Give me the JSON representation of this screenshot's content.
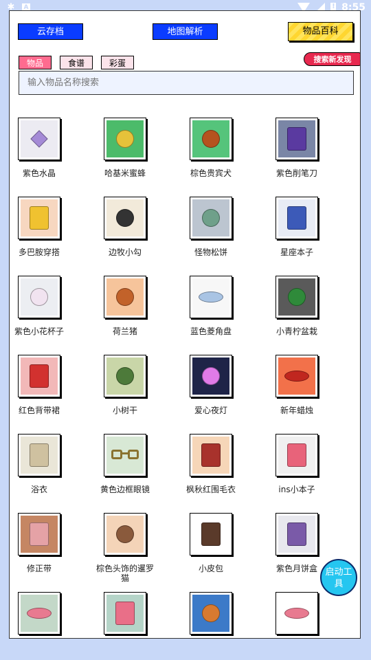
{
  "status_bar": {
    "time": "8:55",
    "left_icons": [
      "bug-icon",
      "a-box-icon"
    ],
    "right_icons": [
      "wifi-icon",
      "signal-icon",
      "battery-alert-icon"
    ]
  },
  "toolbar": {
    "cloud_label": "云存档",
    "map_label": "地图解析",
    "wiki_label": "物品百科"
  },
  "tabs": [
    {
      "label": "物品",
      "active": true
    },
    {
      "label": "食谱",
      "active": false
    },
    {
      "label": "彩蛋",
      "active": false
    }
  ],
  "discovery_badge": "搜索新发现",
  "search": {
    "placeholder": "输入物品名称搜索",
    "value": ""
  },
  "items": [
    {
      "label": "紫色水晶",
      "bg": "#ecebf2",
      "icon": "purple-crystal-icon",
      "color": "#a48ad6",
      "shape": "gem"
    },
    {
      "label": "哈基米蜜蜂",
      "bg": "#4cbb6a",
      "icon": "bee-icon",
      "color": "#e6c23a",
      "shape": "circle"
    },
    {
      "label": "棕色贵宾犬",
      "bg": "#55c47b",
      "icon": "poodle-icon",
      "color": "#b5531f",
      "shape": "circle"
    },
    {
      "label": "紫色削笔刀",
      "bg": "#7a86a6",
      "icon": "pencil-sharpener-icon",
      "color": "#5a3aa0",
      "shape": "rect"
    },
    {
      "label": "多巴胺穿搭",
      "bg": "#f7d7c0",
      "icon": "outfit-icon",
      "color": "#f0c230",
      "shape": "rect"
    },
    {
      "label": "边牧小勾",
      "bg": "#f2eada",
      "icon": "border-collie-icon",
      "color": "#333333",
      "shape": "circle"
    },
    {
      "label": "怪物松饼",
      "bg": "#bcc5d0",
      "icon": "monster-muffin-icon",
      "color": "#6fa08a",
      "shape": "circle"
    },
    {
      "label": "星座本子",
      "bg": "#e8ecf5",
      "icon": "notebook-icon",
      "color": "#3c5ab8",
      "shape": "rect"
    },
    {
      "label": "紫色小花杯子",
      "bg": "#eceef2",
      "icon": "flower-cup-icon",
      "color": "#f1e3f0",
      "shape": "circle"
    },
    {
      "label": "荷兰猪",
      "bg": "#f6c49b",
      "icon": "guinea-pig-icon",
      "color": "#c2622a",
      "shape": "circle"
    },
    {
      "label": "蓝色菱角盘",
      "bg": "#f7f7f7",
      "icon": "plate-icon",
      "color": "#a9c4e4",
      "shape": "ellipse"
    },
    {
      "label": "小青柠盆栽",
      "bg": "#5a5a5a",
      "icon": "lime-plant-icon",
      "color": "#2f8a3a",
      "shape": "circle"
    },
    {
      "label": "红色背带裙",
      "bg": "#f2b8b8",
      "icon": "red-dress-icon",
      "color": "#d2312f",
      "shape": "rect"
    },
    {
      "label": "小树干",
      "bg": "#c9d6a8",
      "icon": "tree-trunk-icon",
      "color": "#4d7a3a",
      "shape": "circle"
    },
    {
      "label": "爱心夜灯",
      "bg": "#1e2448",
      "icon": "heart-lamp-icon",
      "color": "#e07be8",
      "shape": "circle"
    },
    {
      "label": "新年蜡烛",
      "bg": "#f2714a",
      "icon": "candle-icon",
      "color": "#c0271f",
      "shape": "ellipse"
    },
    {
      "label": "浴衣",
      "bg": "#eae6d8",
      "icon": "bathrobe-icon",
      "color": "#cfc1a0",
      "shape": "rect"
    },
    {
      "label": "黄色边框眼镜",
      "bg": "#d8e8d5",
      "icon": "glasses-icon",
      "color": "#8a7330",
      "shape": "glasses"
    },
    {
      "label": "枫秋红围毛衣",
      "bg": "#f6d6b8",
      "icon": "sweater-icon",
      "color": "#a8322c",
      "shape": "rect"
    },
    {
      "label": "ins小本子",
      "bg": "#f0f0f0",
      "icon": "ins-notebook-icon",
      "color": "#e8637a",
      "shape": "rect"
    },
    {
      "label": "修正带",
      "bg": "#c58663",
      "icon": "correction-tape-icon",
      "color": "#e5a2a6",
      "shape": "rect"
    },
    {
      "label": "棕色头饰的暹罗猫",
      "bg": "#f4d4b8",
      "icon": "siamese-cat-icon",
      "color": "#8a5a3c",
      "shape": "circle"
    },
    {
      "label": "小皮包",
      "bg": "#ffffff",
      "icon": "leather-bag-icon",
      "color": "#5a3a2a",
      "shape": "rect"
    },
    {
      "label": "紫色月饼盒",
      "bg": "#e8e8ee",
      "icon": "mooncake-box-icon",
      "color": "#7a5aa8",
      "shape": "rect"
    },
    {
      "label": "",
      "bg": "#c3d8c8",
      "icon": "pink-soap-icon",
      "color": "#e87a90",
      "shape": "ellipse"
    },
    {
      "label": "",
      "bg": "#b5d4c8",
      "icon": "tv-icon",
      "color": "#e96f88",
      "shape": "rect"
    },
    {
      "label": "",
      "bg": "#3c7ac8",
      "icon": "dachshund-icon",
      "color": "#d87a30",
      "shape": "circle"
    },
    {
      "label": "",
      "bg": "#ffffff",
      "icon": "pink-bowl-icon",
      "color": "#e87a90",
      "shape": "ellipse"
    }
  ],
  "fab_label": "启动工具"
}
